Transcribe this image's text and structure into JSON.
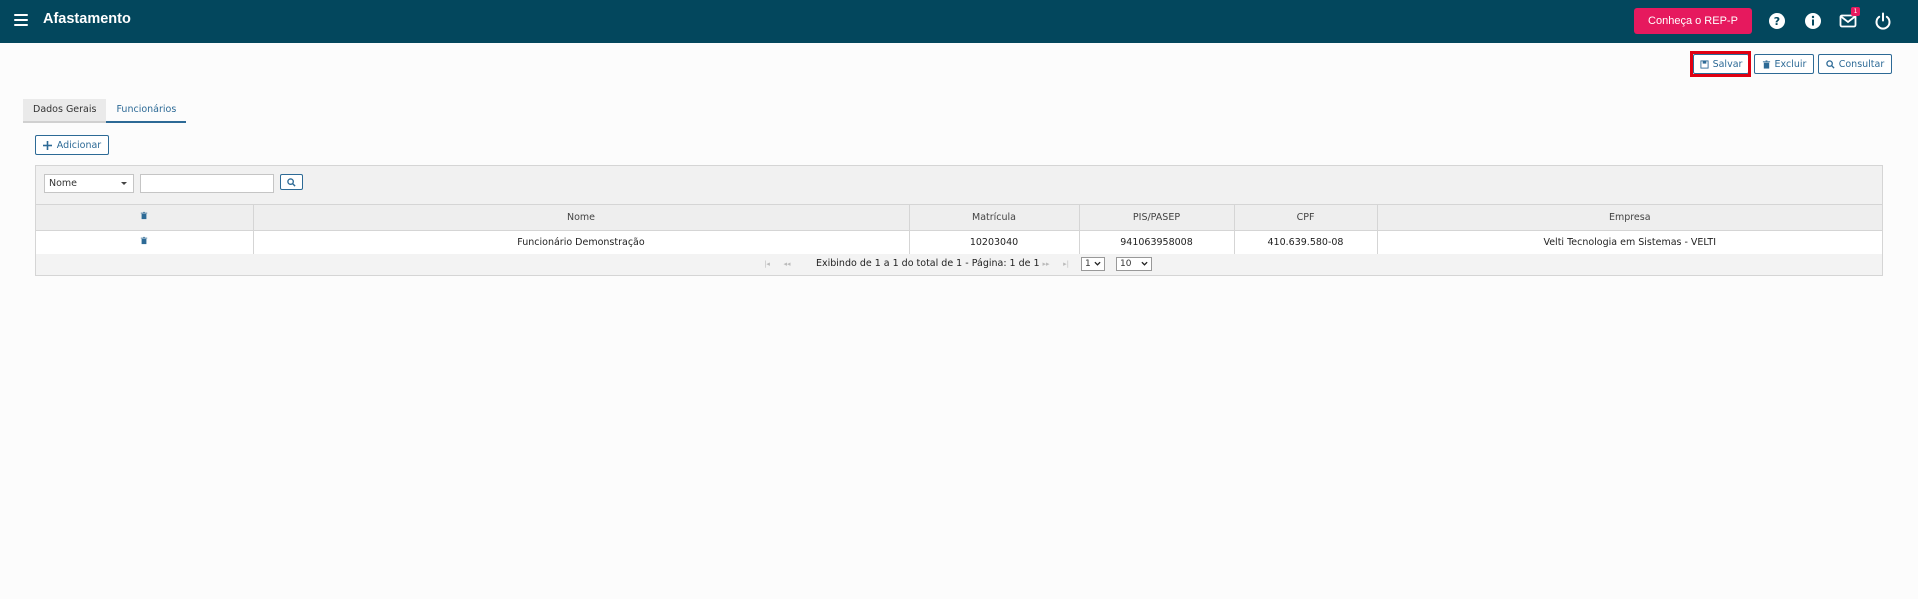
{
  "header": {
    "title": "Afastamento",
    "rep_button": "Conheça o REP-P",
    "notification_count": "1"
  },
  "toolbar": {
    "save_label": "Salvar",
    "delete_label": "Excluir",
    "search_label": "Consultar"
  },
  "tabs": [
    {
      "label": "Dados Gerais",
      "active": false
    },
    {
      "label": "Funcionários",
      "active": true
    }
  ],
  "add_button": "Adicionar",
  "filter": {
    "field_selected": "Nome",
    "search_value": ""
  },
  "table": {
    "columns": [
      "",
      "Nome",
      "Matrícula",
      "PIS/PASEP",
      "CPF",
      "Empresa"
    ],
    "rows": [
      {
        "nome": "Funcionário Demonstração",
        "matricula": "10203040",
        "pis": "941063958008",
        "cpf": "410.639.580-08",
        "empresa": "Velti Tecnologia em Sistemas - VELTI"
      }
    ]
  },
  "pager": {
    "text": "Exibindo de 1 a 1 do total de 1 - Página: 1 de 1",
    "page": "1",
    "page_size": "10"
  },
  "colors": {
    "topbar": "#03475d",
    "accent": "#e6195e",
    "primary": "#2d6a96",
    "highlight": "#e00012"
  }
}
